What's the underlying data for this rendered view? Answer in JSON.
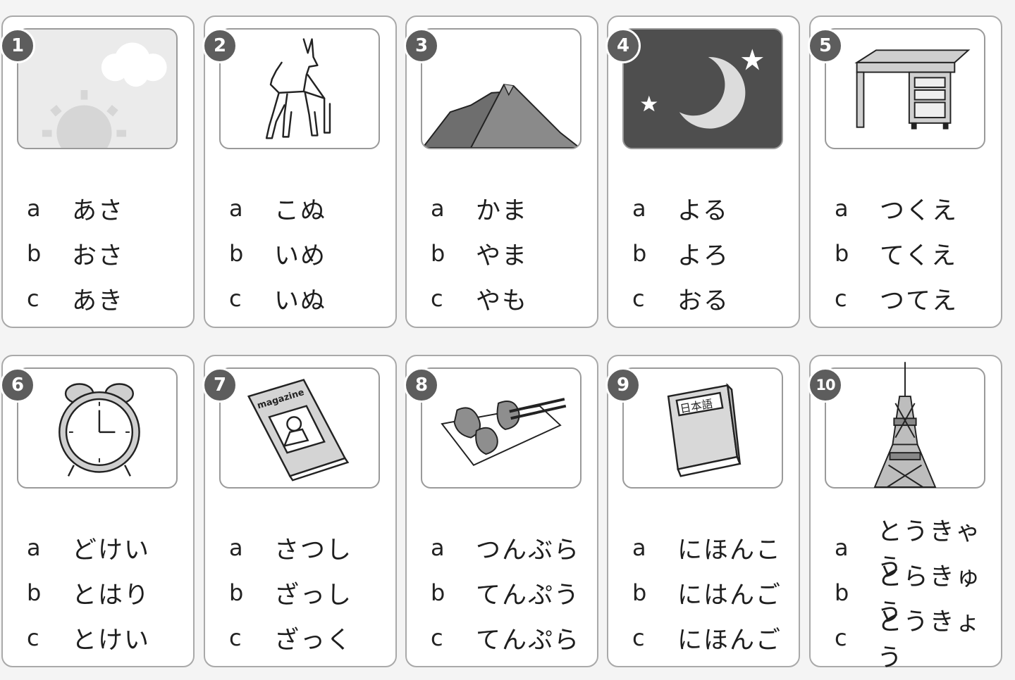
{
  "cards": [
    {
      "number": "1",
      "picture": "sun-clouds-picture",
      "options": [
        {
          "letter": "a",
          "text": "あさ"
        },
        {
          "letter": "b",
          "text": "おさ"
        },
        {
          "letter": "c",
          "text": "あき"
        }
      ]
    },
    {
      "number": "2",
      "picture": "dog-picture",
      "options": [
        {
          "letter": "a",
          "text": "こぬ"
        },
        {
          "letter": "b",
          "text": "いめ"
        },
        {
          "letter": "c",
          "text": "いぬ"
        }
      ]
    },
    {
      "number": "3",
      "picture": "mountain-picture",
      "options": [
        {
          "letter": "a",
          "text": "かま"
        },
        {
          "letter": "b",
          "text": "やま"
        },
        {
          "letter": "c",
          "text": "やも"
        }
      ]
    },
    {
      "number": "4",
      "picture": "night-moon-stars-picture",
      "options": [
        {
          "letter": "a",
          "text": "よる"
        },
        {
          "letter": "b",
          "text": "よろ"
        },
        {
          "letter": "c",
          "text": "おる"
        }
      ]
    },
    {
      "number": "5",
      "picture": "desk-picture",
      "options": [
        {
          "letter": "a",
          "text": "つくえ"
        },
        {
          "letter": "b",
          "text": "てくえ"
        },
        {
          "letter": "c",
          "text": "つてえ"
        }
      ]
    },
    {
      "number": "6",
      "picture": "alarm-clock-picture",
      "options": [
        {
          "letter": "a",
          "text": "どけい"
        },
        {
          "letter": "b",
          "text": "とはり"
        },
        {
          "letter": "c",
          "text": "とけい"
        }
      ]
    },
    {
      "number": "7",
      "picture": "magazine-picture",
      "picture_text": "magazine",
      "options": [
        {
          "letter": "a",
          "text": "さつし"
        },
        {
          "letter": "b",
          "text": "ざっし"
        },
        {
          "letter": "c",
          "text": "ざっく"
        }
      ]
    },
    {
      "number": "8",
      "picture": "tempura-picture",
      "options": [
        {
          "letter": "a",
          "text": "つんぶら"
        },
        {
          "letter": "b",
          "text": "てんぷう"
        },
        {
          "letter": "c",
          "text": "てんぷら"
        }
      ]
    },
    {
      "number": "9",
      "picture": "japanese-book-picture",
      "picture_text": "日本語",
      "options": [
        {
          "letter": "a",
          "text": "にほんこ"
        },
        {
          "letter": "b",
          "text": "にはんご"
        },
        {
          "letter": "c",
          "text": "にほんご"
        }
      ]
    },
    {
      "number": "10",
      "picture": "tokyo-tower-picture",
      "options": [
        {
          "letter": "a",
          "text": "とうきゃう"
        },
        {
          "letter": "b",
          "text": "とらきゅう"
        },
        {
          "letter": "c",
          "text": "とうきょう"
        }
      ]
    }
  ],
  "colors": {
    "badge": "#5d5d5d",
    "border": "#a9a9a9",
    "night_sky": "#4e4e4e",
    "sun": "#d9d9d9"
  }
}
